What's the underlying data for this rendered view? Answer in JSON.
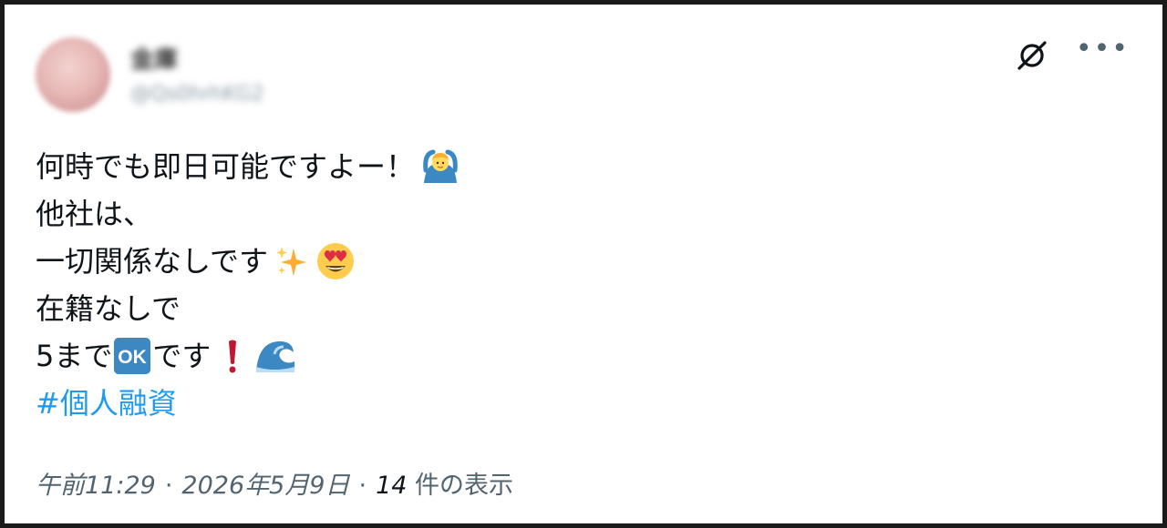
{
  "author": {
    "display_name": "金庫",
    "handle": "@Qs0hrhKG2",
    "avatar_icon": "avatar-image"
  },
  "icons": {
    "grok": "grok-slash-icon",
    "more": "more-dots-icon"
  },
  "post": {
    "lines": [
      "何時でも即日可能ですよー！",
      "他社は、",
      "一切関係なしです",
      "在籍なしで",
      "5まで",
      "です"
    ],
    "hashtag": "#個人融資",
    "emojis": {
      "line1": "person-gesturing-ok-emoji",
      "line3a": "sparkles-emoji",
      "line3b": "heart-eyes-emoji",
      "line5a": "ok-button-emoji",
      "line5b": "exclamation-mark-emoji",
      "line5c": "water-wave-emoji"
    }
  },
  "meta": {
    "time": "午前11:29",
    "date": "2026年5月9日",
    "views_count": "14",
    "views_label": " 件の表示",
    "separator": "·"
  },
  "colors": {
    "text": "#0f1419",
    "secondary": "#536471",
    "link": "#1d9bf0"
  }
}
